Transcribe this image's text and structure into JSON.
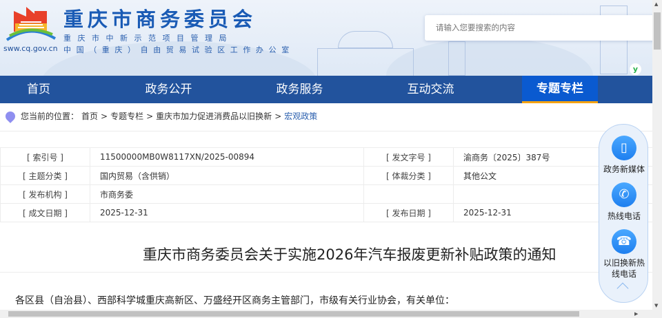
{
  "header": {
    "site_title": "重庆市商务委员会",
    "subtitle_1": "重庆市中新示范项目管理局",
    "subtitle_2": "中国（重庆）自由贸易试验区工作办公室",
    "site_url": "sww.cq.gov.cn",
    "search_placeholder": "请输入您要搜索的内容",
    "badge_icon": "y"
  },
  "nav": {
    "items": [
      {
        "label": "首页"
      },
      {
        "label": "政务公开"
      },
      {
        "label": "政务服务"
      },
      {
        "label": "互动交流"
      },
      {
        "label": "专题专栏",
        "active": true
      }
    ]
  },
  "breadcrumb": {
    "prefix": "您当前的位置：",
    "items": [
      "首页",
      ">",
      "专题专栏",
      ">",
      "重庆市加力促进消费品以旧换新",
      ">",
      "宏观政策"
    ]
  },
  "meta": {
    "rows": [
      [
        "[ 索引号 ]",
        "11500000MB0W8117XN/2025-00894",
        "[ 发文字号 ]",
        "渝商务〔2025〕387号"
      ],
      [
        "[ 主题分类 ]",
        "国内贸易（含供销）",
        "[ 体裁分类 ]",
        "其他公文"
      ],
      [
        "[ 发布机构 ]",
        "市商务委",
        "",
        ""
      ],
      [
        "[ 成文日期 ]",
        "2025-12-31",
        "[ 发布日期 ]",
        "2025-12-31"
      ]
    ]
  },
  "article": {
    "title": "重庆市商务委员会关于实施2026年汽车报废更新补贴政策的通知",
    "first_paragraph": "各区县（自治县）、西部科学城重庆高新区、万盛经开区商务主管部门，市级有关行业协会，有关单位："
  },
  "float_panel": {
    "items": [
      {
        "label": "政务新媒体",
        "icon": "tablet-icon"
      },
      {
        "label": "热线电话",
        "icon": "phone-icon"
      },
      {
        "label": "以旧换新热线电话",
        "icon": "telephone-icon"
      }
    ]
  },
  "colors": {
    "nav_bg": "#22539d",
    "nav_active": "#0a5ad0",
    "accent": "#f5a312"
  }
}
